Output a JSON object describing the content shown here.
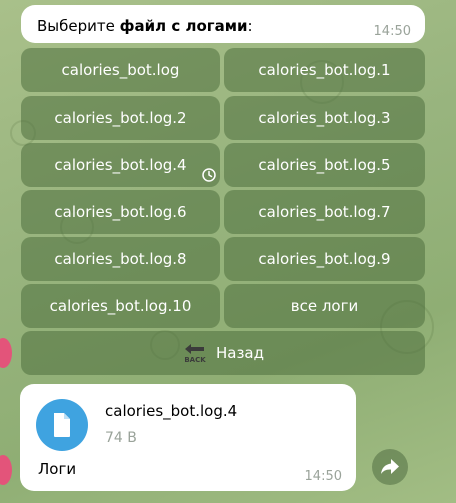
{
  "message": {
    "prefix": "Выберите ",
    "bold": "файл с логами",
    "suffix": ":",
    "time": "14:50"
  },
  "keyboard": {
    "buttons": [
      "calories_bot.log",
      "calories_bot.log.1",
      "calories_bot.log.2",
      "calories_bot.log.3",
      "calories_bot.log.4",
      "calories_bot.log.5",
      "calories_bot.log.6",
      "calories_bot.log.7",
      "calories_bot.log.8",
      "calories_bot.log.9",
      "calories_bot.log.10",
      "все логи"
    ],
    "back_label": "Назад",
    "back_icon_text": "BACK"
  },
  "file_message": {
    "file_name": "calories_bot.log.4",
    "file_size": "74 B",
    "caption": "Логи",
    "time": "14:50",
    "icon": "document-icon"
  },
  "colors": {
    "accent": "#3fa3e0",
    "avatar": "#e3547a"
  }
}
